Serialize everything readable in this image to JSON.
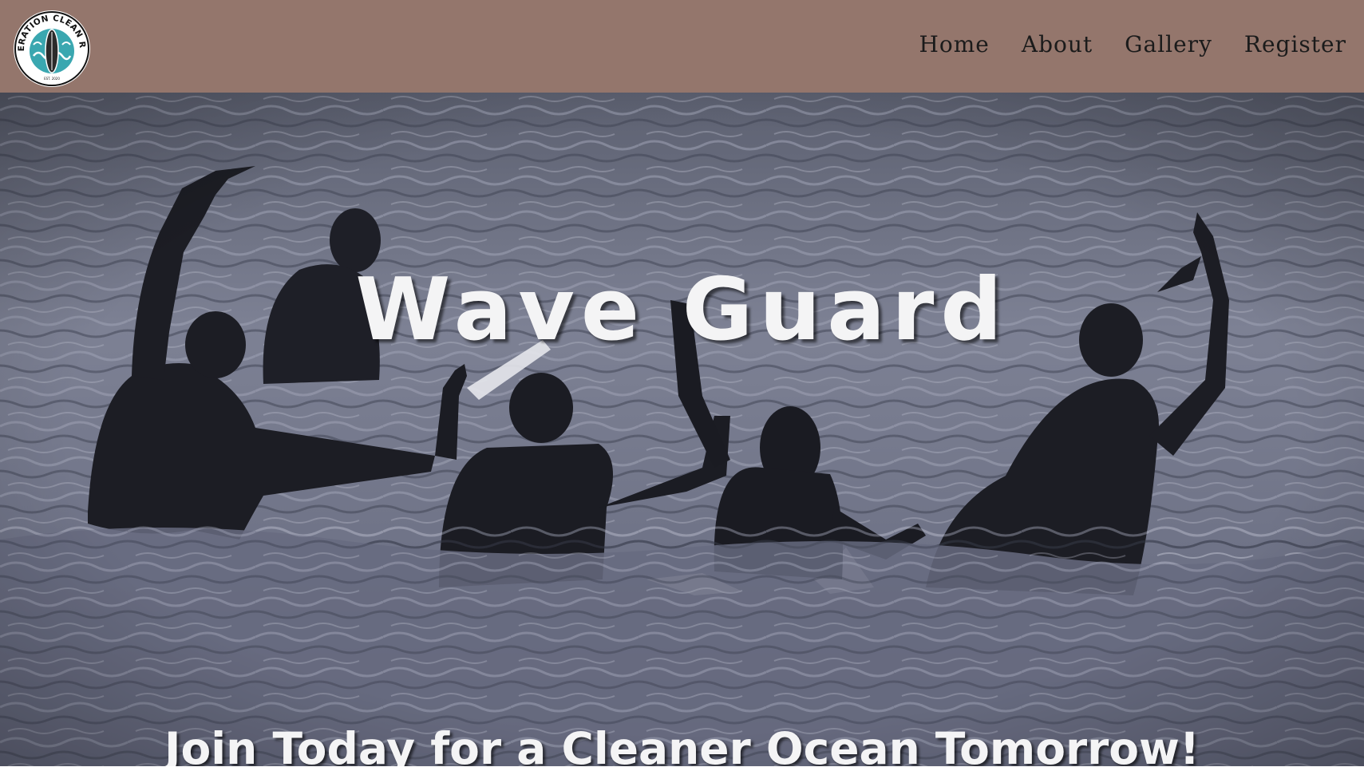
{
  "header": {
    "logo": {
      "icon": "surfboard-logo-icon",
      "text_top": "OPERATION CLEAN RIDE",
      "text_small": "EST. 2020"
    },
    "nav": [
      {
        "label": "Home"
      },
      {
        "label": "About"
      },
      {
        "label": "Gallery"
      },
      {
        "label": "Register"
      }
    ]
  },
  "hero": {
    "title": "Wave Guard",
    "tagline": "Join Today for a Cleaner Ocean Tomorrow!",
    "image": "surfers-in-ocean-photo"
  },
  "colors": {
    "header_bg": "#94766c",
    "text_light": "#f4f4f5",
    "nav_text": "#1b1b1b",
    "logo_accent": "#3aa7b0"
  }
}
